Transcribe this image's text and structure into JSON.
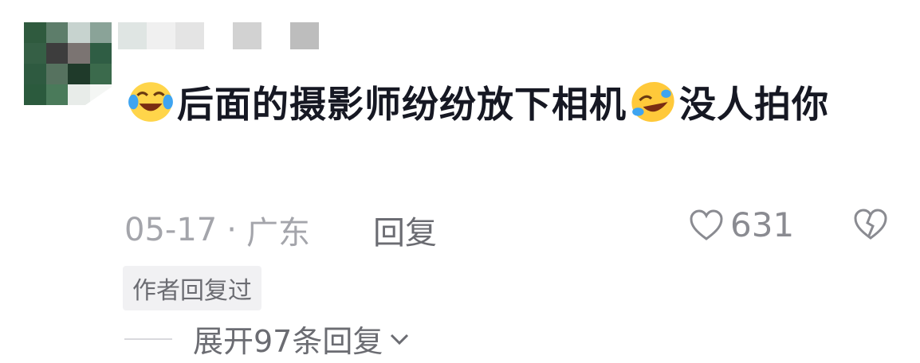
{
  "comment": {
    "text_part1": "后面的摄影师纷纷放下相机",
    "text_part2": "没人拍你",
    "emoji1": "laughing-tears-emoji",
    "emoji2": "rolling-laughing-emoji"
  },
  "meta": {
    "date": "05-17",
    "separator": "·",
    "location": "广东",
    "reply_label": "回复"
  },
  "like": {
    "count": "631",
    "icon": "heart-outline-icon"
  },
  "dislike": {
    "icon": "broken-heart-icon"
  },
  "badge": {
    "label": "作者回复过"
  },
  "expand": {
    "label": "展开97条回复",
    "icon": "chevron-down-icon"
  },
  "colors": {
    "text": "#161823",
    "muted": "#a4a5ab",
    "secondary": "#6b6c72",
    "badge_bg": "#f1f1f3"
  }
}
